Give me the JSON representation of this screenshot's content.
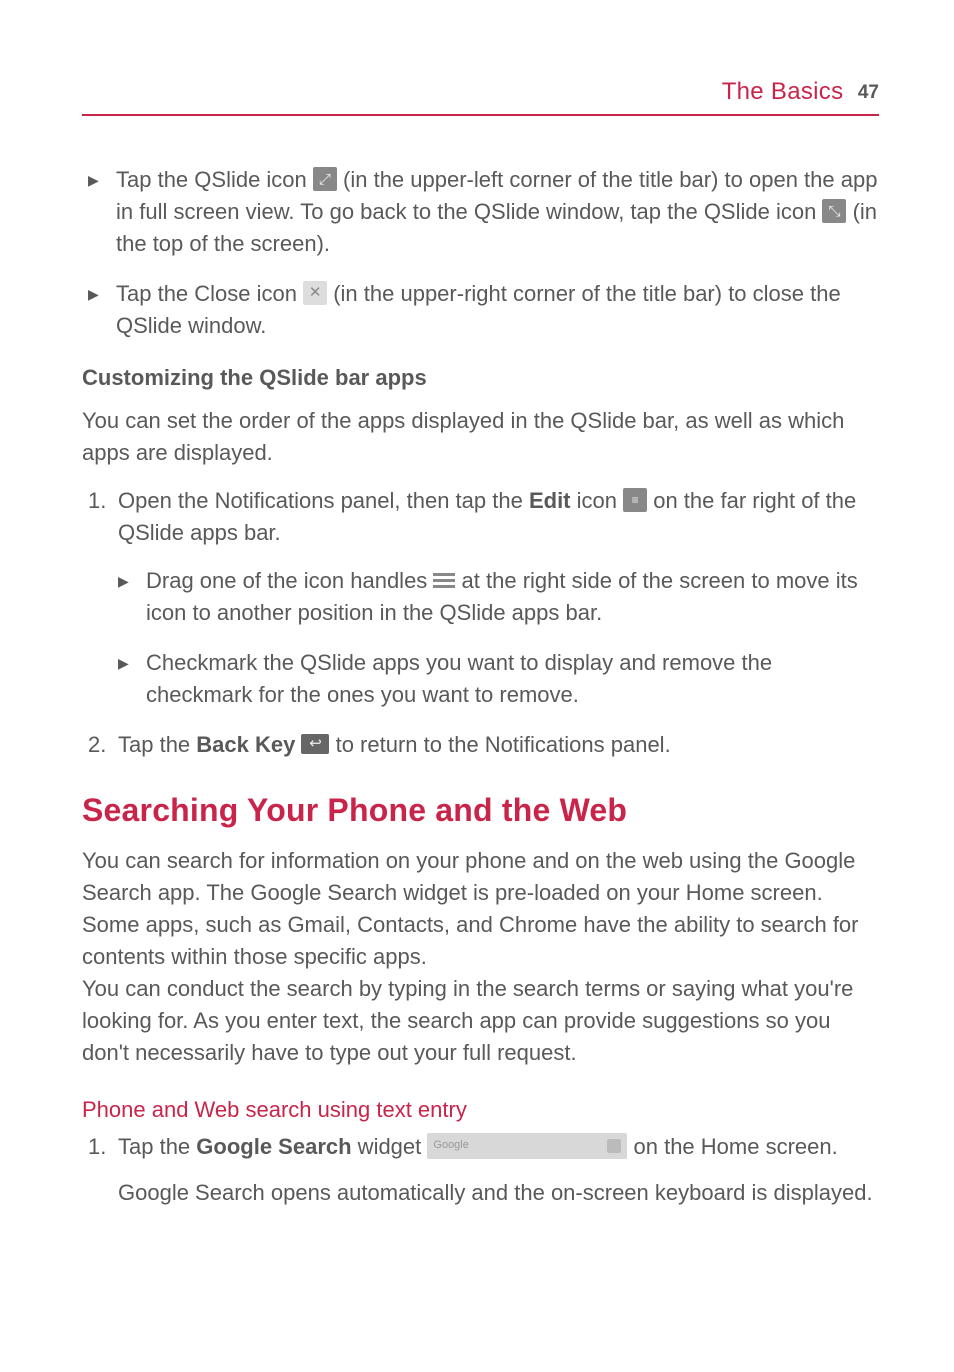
{
  "header": {
    "title": "The Basics",
    "page": "47"
  },
  "top_bullets": [
    {
      "parts": [
        {
          "t": "Tap the QSlide icon "
        },
        {
          "icon": "qslide-expand"
        },
        {
          "t": " (in the upper-left corner of the title bar) to open the app in full screen view. To go back to the QSlide window, tap the QSlide icon "
        },
        {
          "icon": "qslide-collapse"
        },
        {
          "t": " (in the top of the screen)."
        }
      ]
    },
    {
      "parts": [
        {
          "t": "Tap the Close icon "
        },
        {
          "icon": "close"
        },
        {
          "t": " (in the upper-right corner of the title bar) to close the QSlide window."
        }
      ]
    }
  ],
  "customizing": {
    "heading": "Customizing the QSlide bar apps",
    "intro": "You can set the order of the apps displayed in the QSlide bar, as well as which apps are displayed.",
    "step1": {
      "num": "1.",
      "parts": [
        {
          "t": "Open the Notifications panel, then tap the "
        },
        {
          "bold": "Edit"
        },
        {
          "t": " icon "
        },
        {
          "icon": "edit"
        },
        {
          "t": " on the far right of the QSlide apps bar."
        }
      ],
      "subs": [
        {
          "parts": [
            {
              "t": "Drag one of the icon handles "
            },
            {
              "icon": "handle"
            },
            {
              "t": " at the right side of the screen to move its icon to another position in the QSlide apps bar."
            }
          ]
        },
        {
          "parts": [
            {
              "t": "Checkmark the QSlide apps you want to display and remove the checkmark for the ones you want to remove."
            }
          ]
        }
      ]
    },
    "step2": {
      "num": "2.",
      "parts": [
        {
          "t": "Tap the "
        },
        {
          "bold": "Back Key"
        },
        {
          "t": " "
        },
        {
          "icon": "back"
        },
        {
          "t": " to return to the Notifications panel."
        }
      ]
    }
  },
  "searching": {
    "title": "Searching Your Phone and the Web",
    "paras": [
      "You can search for information on your phone and on the web using the Google Search app. The Google Search widget is pre-loaded on your Home screen.",
      "Some apps, such as Gmail, Contacts, and Chrome have the ability to search for contents within those specific apps.",
      "You can conduct the search by typing in the search terms or saying what you're looking for. As you enter text, the search app can provide suggestions so you don't necessarily have to type out your full request."
    ],
    "sub_heading": "Phone and Web search using text entry",
    "step1": {
      "num": "1.",
      "parts": [
        {
          "t": "Tap the "
        },
        {
          "bold": "Google Search"
        },
        {
          "t": " widget "
        },
        {
          "icon": "google-widget"
        },
        {
          "t": " on the Home screen."
        }
      ],
      "followup": "Google Search opens automatically and the on-screen keyboard is displayed."
    }
  },
  "google_label": "Google"
}
